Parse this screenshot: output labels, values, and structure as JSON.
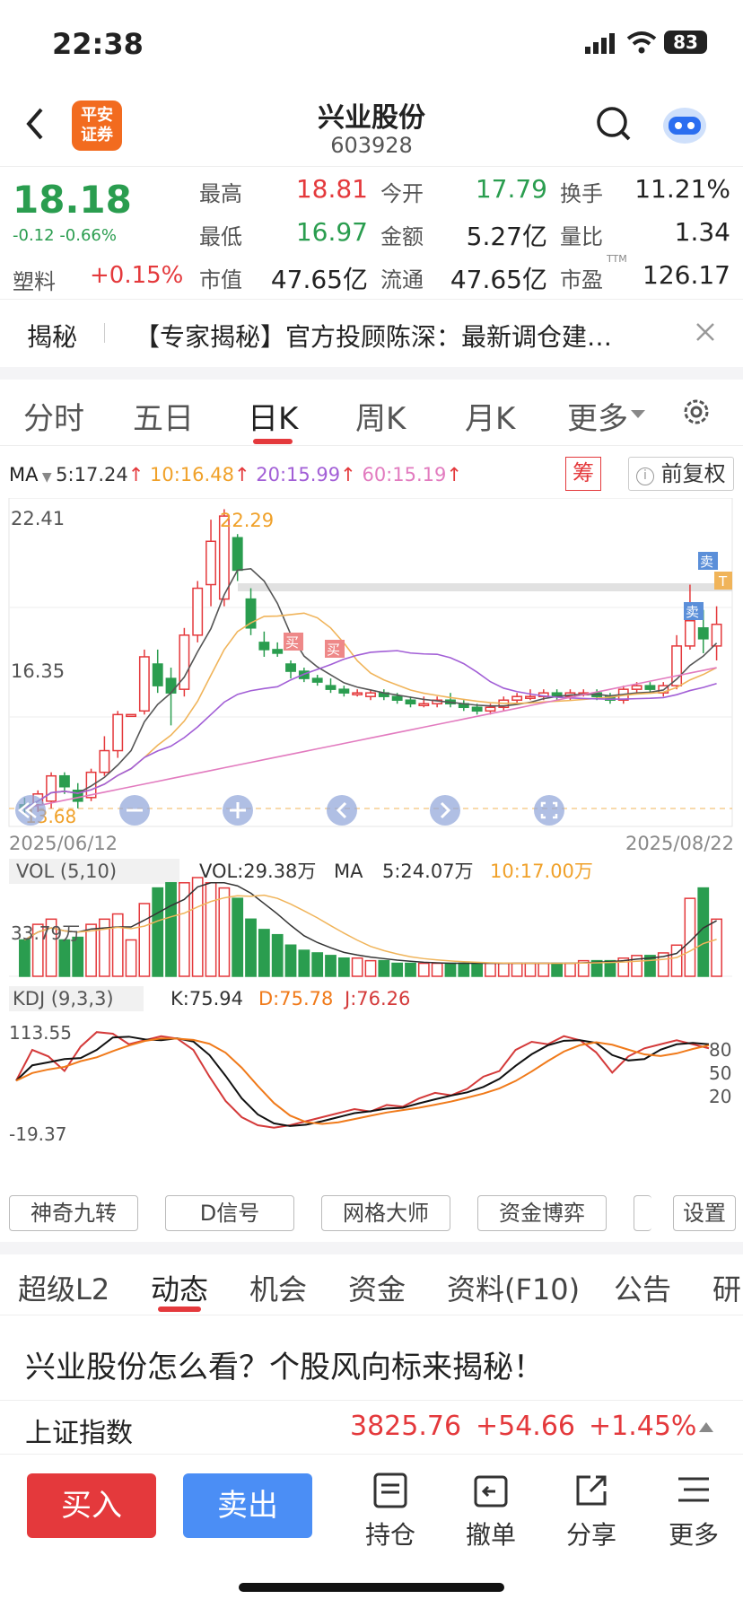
{
  "status": {
    "time": "22:38",
    "battery": "83"
  },
  "nav": {
    "broker_line1": "平安",
    "broker_line2": "证券",
    "name": "兴业股份",
    "code": "603928"
  },
  "quote": {
    "price": "18.18",
    "change": "-0.12",
    "change_pct": "-0.66%",
    "sector": "塑料",
    "sector_change": "+0.15%",
    "high_label": "最高",
    "high": "18.81",
    "open_label": "今开",
    "open": "17.79",
    "turnover_label": "换手",
    "turnover": "11.21%",
    "low_label": "最低",
    "low": "16.97",
    "amount_label": "金额",
    "amount": "5.27亿",
    "vol_ratio_label": "量比",
    "vol_ratio": "1.34",
    "mcap_label": "市值",
    "mcap": "47.65亿",
    "float_label": "流通",
    "float": "47.65亿",
    "pe_label": "市盈",
    "pe_sup": "TTM",
    "pe": "126.17"
  },
  "ticker": {
    "tag": "揭秘",
    "text": "【专家揭秘】官方投顾陈深：最新调仓建…"
  },
  "ktabs": [
    "分时",
    "五日",
    "日K",
    "周K",
    "月K",
    "更多"
  ],
  "ma": {
    "label": "MA",
    "ma5": "5:17.24",
    "ma10": "10:16.48",
    "ma20": "20:15.99",
    "ma60": "60:15.19",
    "chip": "筹",
    "adjust": "前复权"
  },
  "chart": {
    "y_top": "22.41",
    "y_mid": "16.35",
    "peak": "22.29",
    "date_start": "2025/06/12",
    "date_end": "2025/08/22",
    "buy": "买",
    "sell": "卖",
    "t": "T",
    "low_label": "13.68"
  },
  "vol": {
    "label": "VOL (5,10)",
    "vol": "VOL:29.38万",
    "ma": "MA",
    "ma5": "5:24.07万",
    "ma10": "10:17.00万",
    "y": "33.79万"
  },
  "kdj": {
    "label": "KDJ (9,3,3)",
    "k": "K:75.94",
    "d": "D:75.78",
    "j": "J:76.26",
    "y_top": "113.55",
    "y_bot": "-19.37",
    "l80": "80",
    "l50": "50",
    "l20": "20"
  },
  "tools": [
    "神奇九转",
    "D信号",
    "网格大师",
    "资金博弈",
    "设置"
  ],
  "btabs": [
    "超级L2",
    "动态",
    "机会",
    "资金",
    "资料(F10)",
    "公告",
    "研"
  ],
  "headline": "兴业股份怎么看？个股风向标来揭秘！",
  "index": {
    "name": "上证指数",
    "value": "3825.76",
    "change": "+54.66",
    "pct": "+1.45%"
  },
  "bottom": {
    "buy": "买入",
    "sell": "卖出",
    "hold": "持仓",
    "cancel": "撤单",
    "share": "分享",
    "more": "更多"
  },
  "chart_data": [
    {
      "type": "candlestick",
      "title": "日K",
      "ylim": [
        13.5,
        22.6
      ],
      "x_start": "2025/06/12",
      "x_end": "2025/08/22",
      "series": [
        {
          "name": "MA5",
          "last": 17.24
        },
        {
          "name": "MA10",
          "last": 16.48
        },
        {
          "name": "MA20",
          "last": 15.99
        },
        {
          "name": "MA60",
          "last": 15.19
        }
      ],
      "annotations": [
        "22.29"
      ]
    },
    {
      "type": "bar",
      "title": "VOL (5,10)",
      "values_note": "VOL:29.38万",
      "ma5": "24.07万",
      "ma10": "17.00万",
      "ymax": "33.79万"
    },
    {
      "type": "line",
      "title": "KDJ (9,3,3)",
      "K": 75.94,
      "D": 75.78,
      "J": 76.26,
      "ylim": [
        -19.37,
        113.55
      ]
    }
  ]
}
